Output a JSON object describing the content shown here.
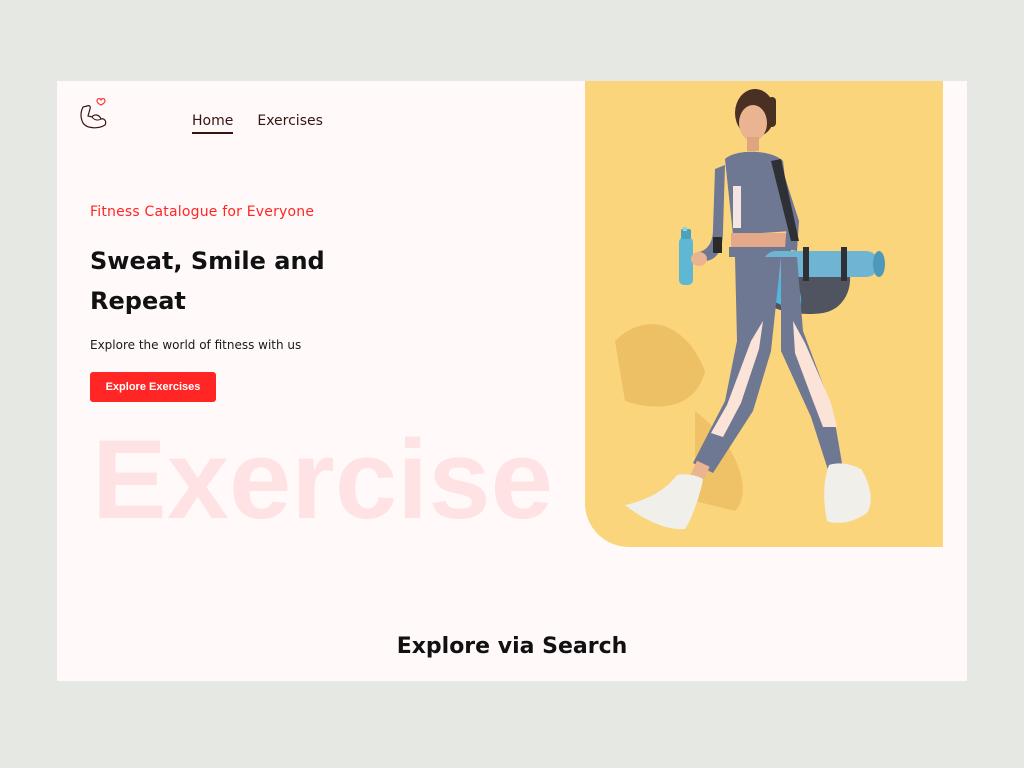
{
  "nav": {
    "logo_icon": "flexed-bicep-heart-icon",
    "items": [
      {
        "label": "Home",
        "active": true
      },
      {
        "label": "Exercises",
        "active": false
      }
    ]
  },
  "hero": {
    "tagline": "Fitness Catalogue for Everyone",
    "headline": "Sweat, Smile and Repeat",
    "subtitle": "Explore the world of fitness with us",
    "cta_label": "Explore Exercises",
    "background_word": "Exercise",
    "image_icon": "woman-walking-with-yoga-mat-photo"
  },
  "search_section": {
    "title": "Explore via Search"
  },
  "colors": {
    "accent": "#ff2625",
    "page_bg": "#fff9fa",
    "outer_bg": "#e6e8e3",
    "hero_bg": "#fad57c",
    "nav_text": "#3a1212"
  }
}
